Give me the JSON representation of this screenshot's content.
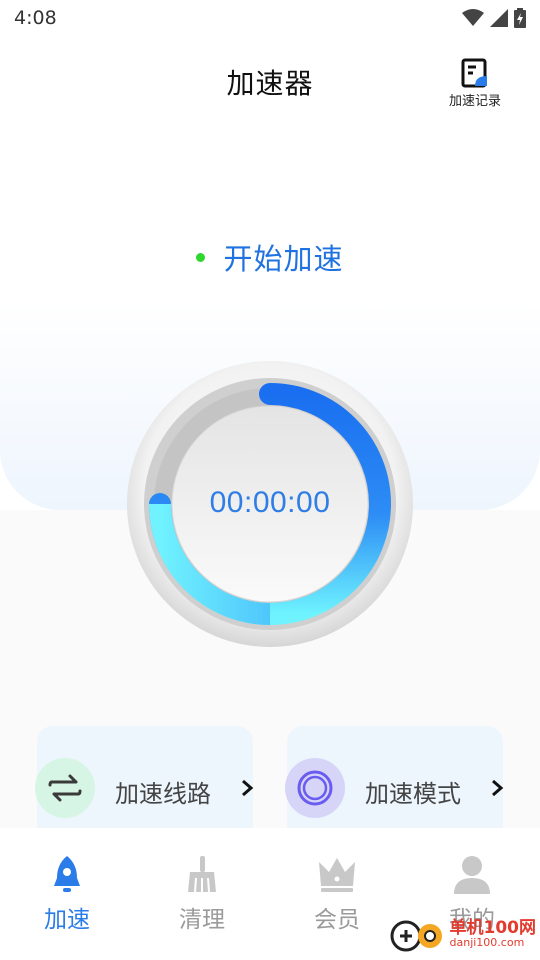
{
  "status_bar": {
    "time": "4:08",
    "icons": [
      "wifi-icon",
      "signal-icon",
      "battery-charging-icon"
    ]
  },
  "header": {
    "title": "加速器",
    "history_label": "加速记录"
  },
  "status": {
    "start_label": "开始加速",
    "dot_color": "#2ed62e"
  },
  "dial": {
    "timer": "00:00:00"
  },
  "cards": {
    "route_label": "加速线路",
    "mode_label": "加速模式"
  },
  "bottom_nav": {
    "items": [
      {
        "label": "加速",
        "icon": "rocket-icon",
        "active": true
      },
      {
        "label": "清理",
        "icon": "broom-icon",
        "active": false
      },
      {
        "label": "会员",
        "icon": "crown-icon",
        "active": false
      },
      {
        "label": "我的",
        "icon": "user-icon",
        "active": false
      }
    ]
  },
  "watermark": {
    "text": "单机100网",
    "sub": "danji100.com"
  },
  "colors": {
    "accent": "#1f72e0",
    "inactive": "#9a9a9a",
    "dial_gradient_start": "#1a6ff0",
    "dial_gradient_end": "#6ef3ff"
  }
}
